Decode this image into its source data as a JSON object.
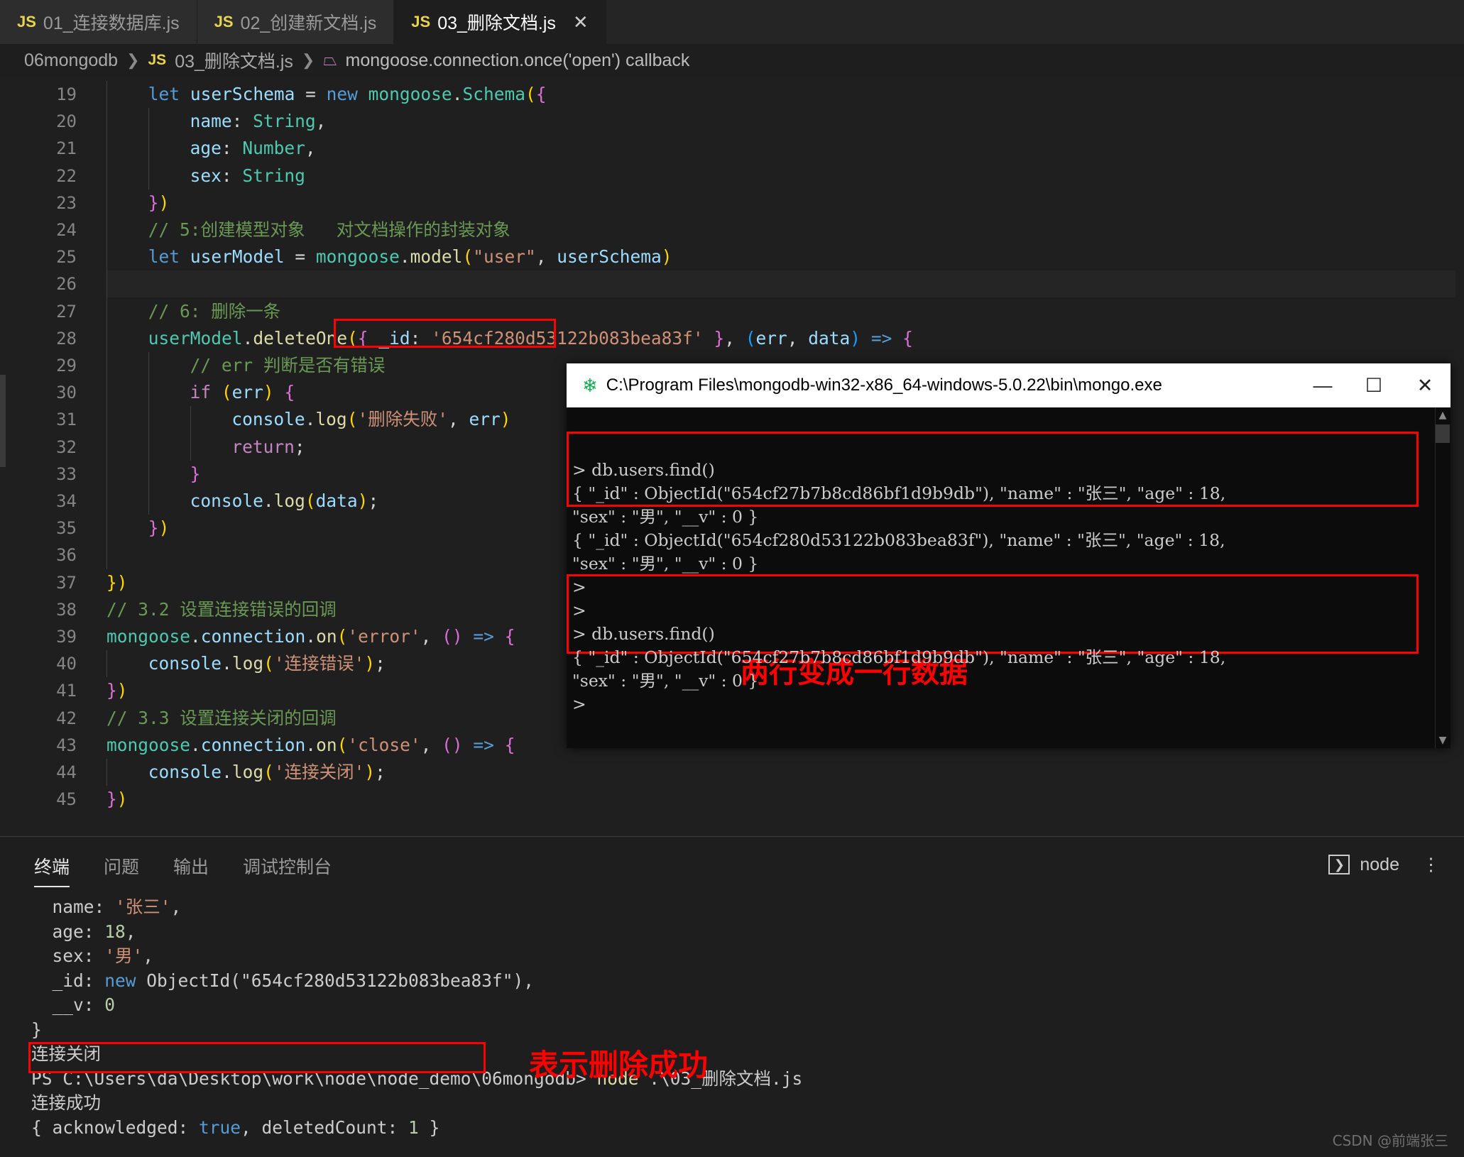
{
  "window": {
    "app": "Visual Studio Code"
  },
  "tabs": [
    {
      "icon": "js-file-icon",
      "label": "01_连接数据库.js",
      "active": false,
      "closable": false
    },
    {
      "icon": "js-file-icon",
      "label": "02_创建新文档.js",
      "active": false,
      "closable": false
    },
    {
      "icon": "js-file-icon",
      "label": "03_删除文档.js",
      "active": true,
      "closable": true,
      "close": "✕"
    }
  ],
  "breadcrumb": {
    "folder": "06mongodb",
    "sep": "❯",
    "file": "03_删除文档.js",
    "symbol": "mongoose.connection.once('open') callback",
    "js_badge": "JS",
    "symbol_icon": "cube-icon"
  },
  "editor": {
    "first_line": 19,
    "lines": [
      {
        "n": 19,
        "segments": [
          {
            "t": "key",
            "s": "let"
          },
          {
            "t": "plain",
            "s": " "
          },
          {
            "t": "var",
            "s": "userSchema"
          },
          {
            "t": "plain",
            "s": " "
          },
          {
            "t": "op",
            "s": "="
          },
          {
            "t": "plain",
            "s": " "
          },
          {
            "t": "key",
            "s": "new"
          },
          {
            "t": "plain",
            "s": " "
          },
          {
            "t": "class",
            "s": "mongoose"
          },
          {
            "t": "plain",
            "s": "."
          },
          {
            "t": "class",
            "s": "Schema"
          },
          {
            "t": "paren1",
            "s": "("
          },
          {
            "t": "paren2",
            "s": "{"
          }
        ],
        "indent": 4
      },
      {
        "n": 20,
        "segments": [
          {
            "t": "var",
            "s": "name"
          },
          {
            "t": "plain",
            "s": ": "
          },
          {
            "t": "class",
            "s": "String"
          },
          {
            "t": "plain",
            "s": ","
          }
        ],
        "indent": 8
      },
      {
        "n": 21,
        "segments": [
          {
            "t": "var",
            "s": "age"
          },
          {
            "t": "plain",
            "s": ": "
          },
          {
            "t": "class",
            "s": "Number"
          },
          {
            "t": "plain",
            "s": ","
          }
        ],
        "indent": 8
      },
      {
        "n": 22,
        "segments": [
          {
            "t": "var",
            "s": "sex"
          },
          {
            "t": "plain",
            "s": ": "
          },
          {
            "t": "class",
            "s": "String"
          }
        ],
        "indent": 8
      },
      {
        "n": 23,
        "segments": [
          {
            "t": "paren2",
            "s": "}"
          },
          {
            "t": "paren1",
            "s": ")"
          }
        ],
        "indent": 4
      },
      {
        "n": 24,
        "segments": [
          {
            "t": "com",
            "s": "// 5:创建模型对象   对文档操作的封装对象"
          }
        ],
        "indent": 4
      },
      {
        "n": 25,
        "segments": [
          {
            "t": "key",
            "s": "let"
          },
          {
            "t": "plain",
            "s": " "
          },
          {
            "t": "var",
            "s": "userModel"
          },
          {
            "t": "plain",
            "s": " "
          },
          {
            "t": "op",
            "s": "="
          },
          {
            "t": "plain",
            "s": " "
          },
          {
            "t": "class",
            "s": "mongoose"
          },
          {
            "t": "plain",
            "s": "."
          },
          {
            "t": "fn",
            "s": "model"
          },
          {
            "t": "paren1",
            "s": "("
          },
          {
            "t": "str",
            "s": "\"user\""
          },
          {
            "t": "plain",
            "s": ", "
          },
          {
            "t": "var",
            "s": "userSchema"
          },
          {
            "t": "paren1",
            "s": ")"
          }
        ],
        "indent": 4
      },
      {
        "n": 26,
        "segments": [],
        "indent": 4,
        "empty_highlight": true
      },
      {
        "n": 27,
        "segments": [
          {
            "t": "com",
            "s": "// 6: 删除一条"
          }
        ],
        "indent": 4
      },
      {
        "n": 28,
        "segments": [
          {
            "t": "class",
            "s": "userModel"
          },
          {
            "t": "plain",
            "s": "."
          },
          {
            "t": "fn",
            "s": "deleteOne"
          },
          {
            "t": "paren1",
            "s": "("
          },
          {
            "t": "paren2",
            "s": "{"
          },
          {
            "t": "plain",
            "s": " "
          },
          {
            "t": "var",
            "s": "_id"
          },
          {
            "t": "plain",
            "s": ": "
          },
          {
            "t": "str",
            "s": "'654cf280d53122b083bea83f'"
          },
          {
            "t": "plain",
            "s": " "
          },
          {
            "t": "paren2",
            "s": "}"
          },
          {
            "t": "plain",
            "s": ", "
          },
          {
            "t": "paren3",
            "s": "("
          },
          {
            "t": "var",
            "s": "err"
          },
          {
            "t": "plain",
            "s": ", "
          },
          {
            "t": "var",
            "s": "data"
          },
          {
            "t": "paren3",
            "s": ")"
          },
          {
            "t": "plain",
            "s": " "
          },
          {
            "t": "key",
            "s": "=>"
          },
          {
            "t": "plain",
            "s": " "
          },
          {
            "t": "paren2",
            "s": "{"
          }
        ],
        "indent": 4
      },
      {
        "n": 29,
        "segments": [
          {
            "t": "com",
            "s": "// err 判断是否有错误"
          }
        ],
        "indent": 8
      },
      {
        "n": 30,
        "segments": [
          {
            "t": "key2",
            "s": "if"
          },
          {
            "t": "plain",
            "s": " "
          },
          {
            "t": "paren1",
            "s": "("
          },
          {
            "t": "var",
            "s": "err"
          },
          {
            "t": "paren1",
            "s": ")"
          },
          {
            "t": "plain",
            "s": " "
          },
          {
            "t": "paren2",
            "s": "{"
          }
        ],
        "indent": 8
      },
      {
        "n": 31,
        "segments": [
          {
            "t": "var",
            "s": "console"
          },
          {
            "t": "plain",
            "s": "."
          },
          {
            "t": "fn",
            "s": "log"
          },
          {
            "t": "paren1",
            "s": "("
          },
          {
            "t": "str",
            "s": "'删除失败'"
          },
          {
            "t": "plain",
            "s": ", "
          },
          {
            "t": "var",
            "s": "err"
          },
          {
            "t": "paren1",
            "s": ")"
          }
        ],
        "indent": 12
      },
      {
        "n": 32,
        "segments": [
          {
            "t": "key2",
            "s": "return"
          },
          {
            "t": "plain",
            "s": ";"
          }
        ],
        "indent": 12
      },
      {
        "n": 33,
        "segments": [
          {
            "t": "paren2",
            "s": "}"
          }
        ],
        "indent": 8
      },
      {
        "n": 34,
        "segments": [
          {
            "t": "var",
            "s": "console"
          },
          {
            "t": "plain",
            "s": "."
          },
          {
            "t": "fn",
            "s": "log"
          },
          {
            "t": "paren1",
            "s": "("
          },
          {
            "t": "var",
            "s": "data"
          },
          {
            "t": "paren1",
            "s": ")"
          },
          {
            "t": "plain",
            "s": ";"
          }
        ],
        "indent": 8
      },
      {
        "n": 35,
        "segments": [
          {
            "t": "paren2",
            "s": "}"
          },
          {
            "t": "paren1",
            "s": ")"
          }
        ],
        "indent": 4
      },
      {
        "n": 36,
        "segments": [],
        "indent": 4
      },
      {
        "n": 37,
        "segments": [
          {
            "t": "paren1",
            "s": "}"
          },
          {
            "t": "paren1",
            "s": ")"
          }
        ],
        "indent": 0
      },
      {
        "n": 38,
        "segments": [
          {
            "t": "com",
            "s": "// 3.2 设置连接错误的回调"
          }
        ],
        "indent": 0
      },
      {
        "n": 39,
        "segments": [
          {
            "t": "class",
            "s": "mongoose"
          },
          {
            "t": "plain",
            "s": "."
          },
          {
            "t": "var",
            "s": "connection"
          },
          {
            "t": "plain",
            "s": "."
          },
          {
            "t": "fn",
            "s": "on"
          },
          {
            "t": "paren1",
            "s": "("
          },
          {
            "t": "str",
            "s": "'error'"
          },
          {
            "t": "plain",
            "s": ", "
          },
          {
            "t": "paren2",
            "s": "("
          },
          {
            "t": "paren2",
            "s": ")"
          },
          {
            "t": "plain",
            "s": " "
          },
          {
            "t": "key",
            "s": "=>"
          },
          {
            "t": "plain",
            "s": " "
          },
          {
            "t": "paren2",
            "s": "{"
          }
        ],
        "indent": 0
      },
      {
        "n": 40,
        "segments": [
          {
            "t": "var",
            "s": "console"
          },
          {
            "t": "plain",
            "s": "."
          },
          {
            "t": "fn",
            "s": "log"
          },
          {
            "t": "paren1",
            "s": "("
          },
          {
            "t": "str",
            "s": "'连接错误'"
          },
          {
            "t": "paren1",
            "s": ")"
          },
          {
            "t": "plain",
            "s": ";"
          }
        ],
        "indent": 4
      },
      {
        "n": 41,
        "segments": [
          {
            "t": "paren2",
            "s": "}"
          },
          {
            "t": "paren1",
            "s": ")"
          }
        ],
        "indent": 0
      },
      {
        "n": 42,
        "segments": [
          {
            "t": "com",
            "s": "// 3.3 设置连接关闭的回调"
          }
        ],
        "indent": 0
      },
      {
        "n": 43,
        "segments": [
          {
            "t": "class",
            "s": "mongoose"
          },
          {
            "t": "plain",
            "s": "."
          },
          {
            "t": "var",
            "s": "connection"
          },
          {
            "t": "plain",
            "s": "."
          },
          {
            "t": "fn",
            "s": "on"
          },
          {
            "t": "paren1",
            "s": "("
          },
          {
            "t": "str",
            "s": "'close'"
          },
          {
            "t": "plain",
            "s": ", "
          },
          {
            "t": "paren2",
            "s": "("
          },
          {
            "t": "paren2",
            "s": ")"
          },
          {
            "t": "plain",
            "s": " "
          },
          {
            "t": "key",
            "s": "=>"
          },
          {
            "t": "plain",
            "s": " "
          },
          {
            "t": "paren2",
            "s": "{"
          }
        ],
        "indent": 0
      },
      {
        "n": 44,
        "segments": [
          {
            "t": "var",
            "s": "console"
          },
          {
            "t": "plain",
            "s": "."
          },
          {
            "t": "fn",
            "s": "log"
          },
          {
            "t": "paren1",
            "s": "("
          },
          {
            "t": "str",
            "s": "'连接关闭'"
          },
          {
            "t": "paren1",
            "s": ")"
          },
          {
            "t": "plain",
            "s": ";"
          }
        ],
        "indent": 4
      },
      {
        "n": 45,
        "segments": [
          {
            "t": "paren2",
            "s": "}"
          },
          {
            "t": "paren1",
            "s": ")"
          }
        ],
        "indent": 0
      }
    ]
  },
  "mongo_console": {
    "title": "C:\\Program Files\\mongodb-win32-x86_64-windows-5.0.22\\bin\\mongo.exe",
    "title_icon": "mongodb-leaf-icon",
    "controls": {
      "minimize": "—",
      "maximize": "☐",
      "close": "✕"
    },
    "lines": [
      "> db.users.find()",
      "{ \"_id\" : ObjectId(\"654cf27b7b8cd86bf1d9b9db\"), \"name\" : \"张三\", \"age\" : 18,",
      "\"sex\" : \"男\", \"__v\" : 0 }",
      "{ \"_id\" : ObjectId(\"654cf280d53122b083bea83f\"), \"name\" : \"张三\", \"age\" : 18,",
      "\"sex\" : \"男\", \"__v\" : 0 }",
      ">",
      ">",
      "> db.users.find()",
      "{ \"_id\" : ObjectId(\"654cf27b7b8cd86bf1d9b9db\"), \"name\" : \"张三\", \"age\" : 18,",
      "\"sex\" : \"男\", \"__v\" : 0 }",
      ">"
    ],
    "annotation": "两行变成一行数据"
  },
  "annotations": {
    "objectid_box_label": "",
    "delete_success_label": "表示删除成功"
  },
  "panel": {
    "tabs": [
      {
        "label": "终端",
        "active": true
      },
      {
        "label": "问题",
        "active": false
      },
      {
        "label": "输出",
        "active": false
      },
      {
        "label": "调试控制台",
        "active": false
      }
    ],
    "right": {
      "icon": "chevron-right-box-icon",
      "label": "node"
    },
    "terminal_lines": [
      [
        {
          "t": "plain",
          "s": "  name: "
        },
        {
          "t": "str",
          "s": "'张三'"
        },
        {
          "t": "plain",
          "s": ","
        }
      ],
      [
        {
          "t": "plain",
          "s": "  age: "
        },
        {
          "t": "num",
          "s": "18"
        },
        {
          "t": "plain",
          "s": ","
        }
      ],
      [
        {
          "t": "plain",
          "s": "  sex: "
        },
        {
          "t": "str",
          "s": "'男'"
        },
        {
          "t": "plain",
          "s": ","
        }
      ],
      [
        {
          "t": "plain",
          "s": "  _id: "
        },
        {
          "t": "kw",
          "s": "new"
        },
        {
          "t": "plain",
          "s": " ObjectId(\"654cf280d53122b083bea83f\"),"
        }
      ],
      [
        {
          "t": "plain",
          "s": "  __v: "
        },
        {
          "t": "num",
          "s": "0"
        }
      ],
      [
        {
          "t": "plain",
          "s": "}"
        }
      ],
      [
        {
          "t": "plain",
          "s": "连接关闭"
        }
      ],
      [
        {
          "t": "plain",
          "s": "PS C:\\Users\\da\\Desktop\\work\\node\\node_demo\\06mongodb> "
        },
        {
          "t": "cmd",
          "s": "node"
        },
        {
          "t": "plain",
          "s": " .\\03_删除文档.js"
        }
      ],
      [
        {
          "t": "plain",
          "s": "连接成功"
        }
      ],
      [
        {
          "t": "plain",
          "s": "{ acknowledged: "
        },
        {
          "t": "bool",
          "s": "true"
        },
        {
          "t": "plain",
          "s": ", deletedCount: "
        },
        {
          "t": "num",
          "s": "1"
        },
        {
          "t": "plain",
          "s": " }"
        }
      ]
    ]
  },
  "watermark": "CSDN @前端张三",
  "colors": {
    "annotation_red": "#ff0000",
    "editor_bg": "#1f1f1f",
    "tabbar_bg": "#252526",
    "console_bg": "#0c0c0c",
    "mongo_green": "#13aa52"
  }
}
